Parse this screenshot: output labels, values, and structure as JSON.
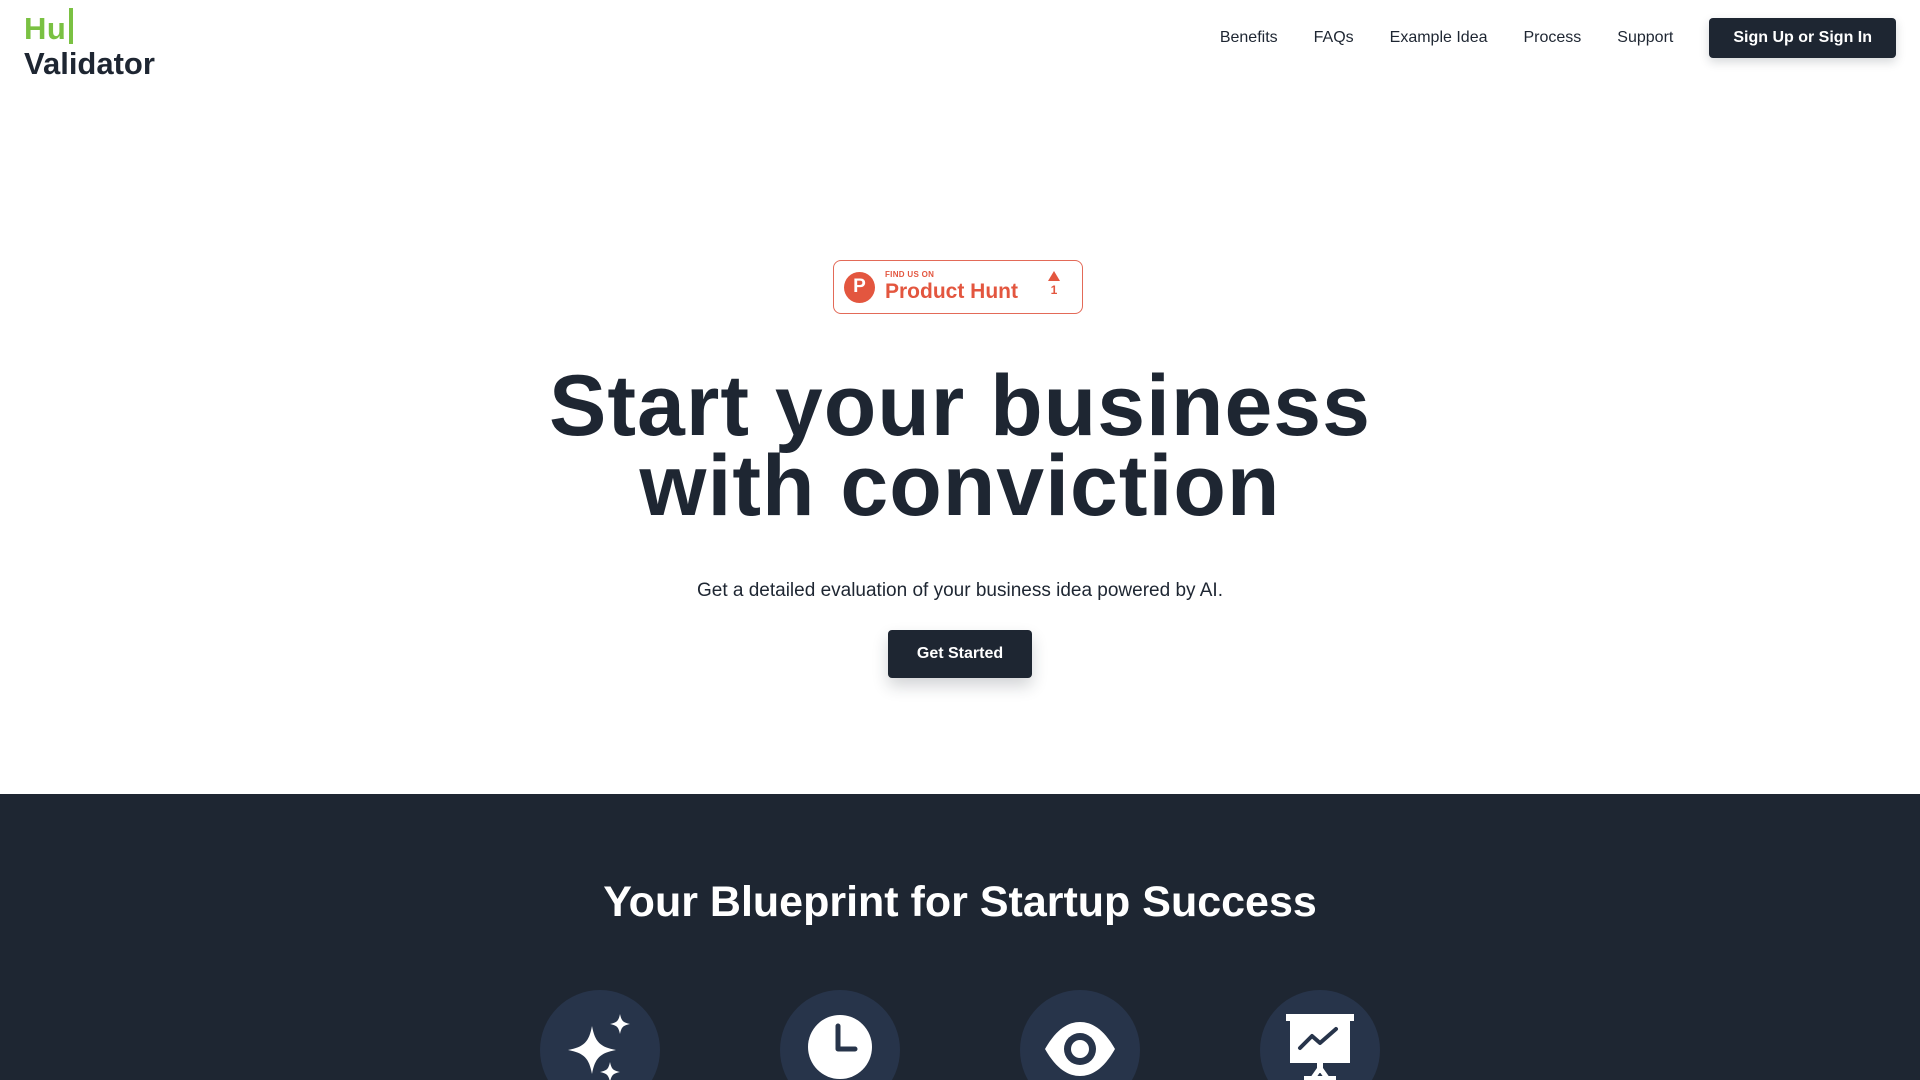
{
  "header": {
    "logo": {
      "top": "Hu",
      "bottom": "Validator"
    },
    "nav": [
      "Benefits",
      "FAQs",
      "Example Idea",
      "Process",
      "Support"
    ],
    "cta": "Sign Up or Sign In"
  },
  "product_hunt": {
    "find_text": "FIND US ON",
    "name": "Product Hunt",
    "logo_letter": "P",
    "votes": "1"
  },
  "hero": {
    "title_line1": "Start your business",
    "title_line2": "with conviction",
    "subtitle": "Get a detailed evaluation of your business idea powered by AI.",
    "cta": "Get Started"
  },
  "blueprint": {
    "title": "Your Blueprint for Startup Success",
    "icons": [
      "sparkles-icon",
      "clock-icon",
      "eye-icon",
      "presentation-chart-icon"
    ]
  },
  "colors": {
    "brand_green": "#7ac142",
    "navy": "#1e2632",
    "icon_circle": "#27344a",
    "product_hunt": "#e3563f"
  }
}
